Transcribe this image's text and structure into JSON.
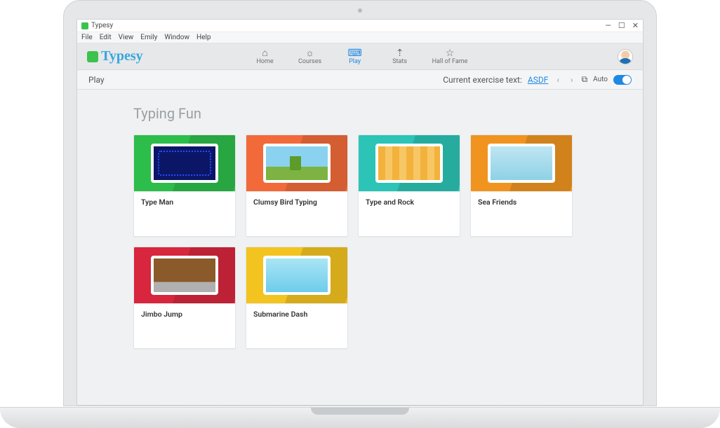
{
  "window": {
    "title": "Typesy"
  },
  "menubar": [
    "File",
    "Edit",
    "View",
    "Emily",
    "Window",
    "Help"
  ],
  "brand": "Typesy",
  "nav": [
    {
      "label": "Home",
      "icon": "⌂",
      "active": false
    },
    {
      "label": "Courses",
      "icon": "☼",
      "active": false
    },
    {
      "label": "Play",
      "icon": "⌨",
      "active": true
    },
    {
      "label": "Stats",
      "icon": "⇡",
      "active": false
    },
    {
      "label": "Hall of Fame",
      "icon": "☆",
      "active": false
    }
  ],
  "subheader": {
    "page": "Play",
    "exercisePrefix": "Current exercise text: ",
    "exerciseLink": "ASDF",
    "autoLabel": "Auto",
    "autoOn": true
  },
  "section": {
    "title": "Typing Fun"
  },
  "games": [
    {
      "title": "Type Man",
      "bg": "bg-green",
      "thumb": "g-typeman"
    },
    {
      "title": "Clumsy Bird Typing",
      "bg": "bg-orange",
      "thumb": "g-bird"
    },
    {
      "title": "Type and Rock",
      "bg": "bg-teal",
      "thumb": "g-rock"
    },
    {
      "title": "Sea Friends",
      "bg": "bg-amber",
      "thumb": "g-sea"
    },
    {
      "title": "Jimbo Jump",
      "bg": "bg-red",
      "thumb": "g-jimbo"
    },
    {
      "title": "Submarine Dash",
      "bg": "bg-yellow",
      "thumb": "g-sub"
    }
  ]
}
